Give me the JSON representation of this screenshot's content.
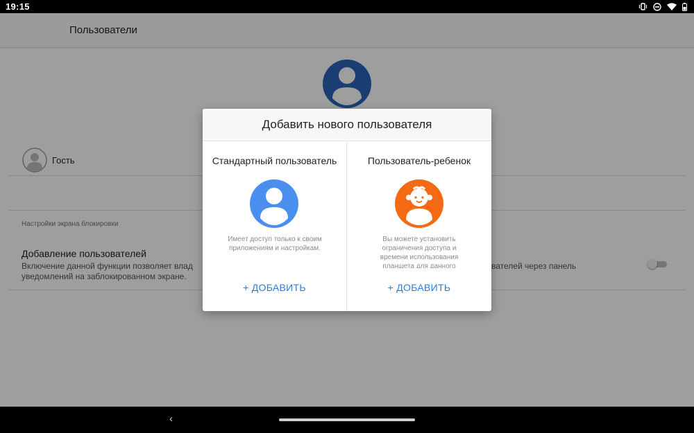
{
  "status_bar": {
    "time": "19:15",
    "icons": [
      "vibrate-icon",
      "do-not-disturb-icon",
      "wifi-icon",
      "battery-icon"
    ]
  },
  "app_bar": {
    "title": "Пользователи"
  },
  "background": {
    "guest_label": "Гость",
    "section_label": "Настройки экрана блокировки",
    "setting_title": "Добавление пользователей",
    "setting_desc_line1_left": "Включение данной функции позволяет влад",
    "setting_desc_line1_right": "вателей через панель",
    "setting_desc_line2": "уведомлений на заблокированном экране.",
    "toggle_on": false
  },
  "dialog": {
    "title": "Добавить нового пользователя",
    "options": [
      {
        "title": "Стандартный пользователь",
        "description": "Имеет доступ только к своим приложениям и настройкам.",
        "add_label": "+ ДОБАВИТЬ",
        "avatar_color": "#4a8ff0"
      },
      {
        "title": "Пользователь-ребенок",
        "description": "Вы можете установить ограничения доступа и времени использования планшета для данного",
        "add_label": "+ ДОБАВИТЬ",
        "avatar_color": "#f56a14"
      }
    ]
  },
  "colors": {
    "accent": "#2f7ad8",
    "owner_avatar": "#2d64b8"
  }
}
